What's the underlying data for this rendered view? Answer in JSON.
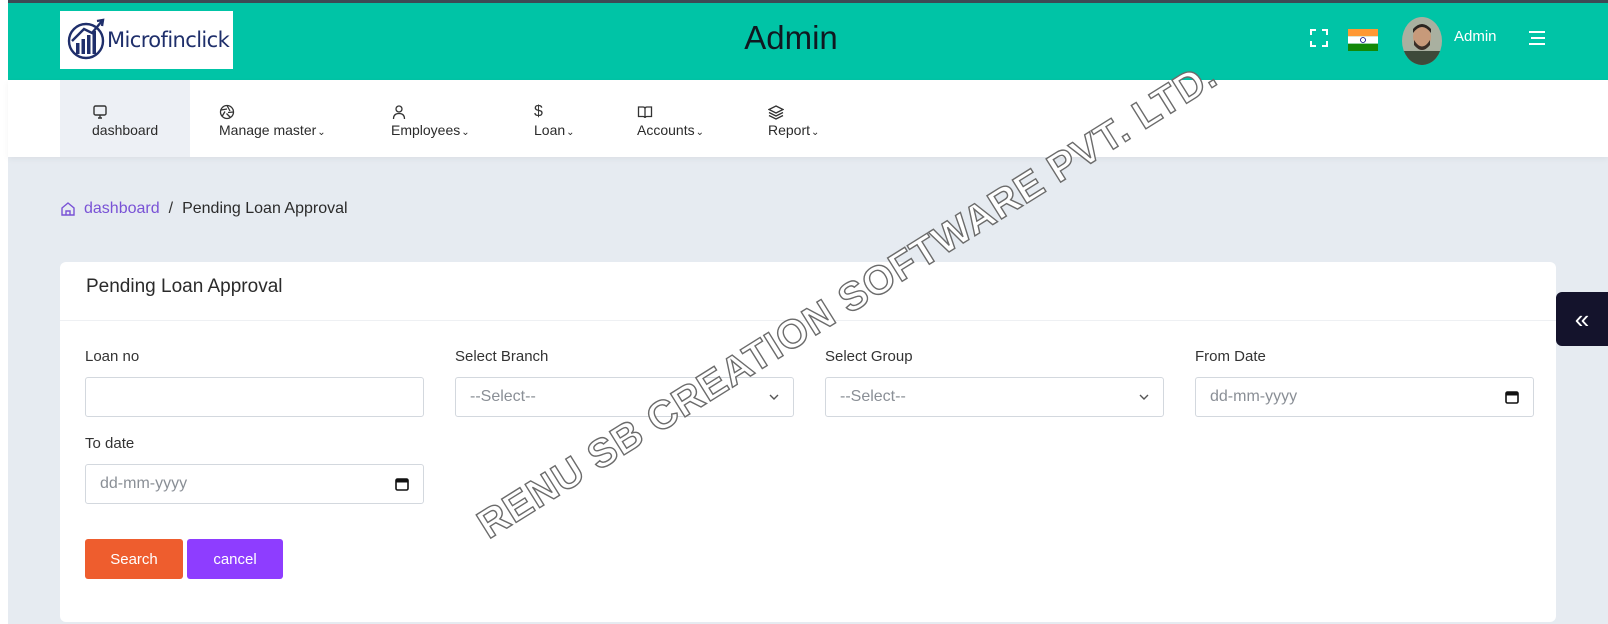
{
  "brand": {
    "logo_text": "Microfinclick"
  },
  "header": {
    "title": "Admin",
    "user_name": "Admin"
  },
  "nav": {
    "items": [
      {
        "label": "dashboard",
        "icon": "monitor-icon",
        "caret": ""
      },
      {
        "label": "Manage master",
        "icon": "aperture-icon",
        "caret": "⌄"
      },
      {
        "label": "Employees",
        "icon": "user-icon",
        "caret": "⌄"
      },
      {
        "label": "Loan",
        "icon": "dollar-icon",
        "caret": "⌄"
      },
      {
        "label": "Accounts",
        "icon": "book-icon",
        "caret": "⌄"
      },
      {
        "label": "Report",
        "icon": "layers-icon",
        "caret": "⌄"
      }
    ]
  },
  "breadcrumb": {
    "home": "dashboard",
    "separator": "/",
    "current": "Pending Loan Approval"
  },
  "form": {
    "title": "Pending Loan Approval",
    "loan_no": {
      "label": "Loan no",
      "value": ""
    },
    "branch": {
      "label": "Select Branch",
      "selected": "--Select--"
    },
    "group": {
      "label": "Select Group",
      "selected": "--Select--"
    },
    "from_date": {
      "label": "From Date",
      "placeholder": "dd-mm-yyyy"
    },
    "to_date": {
      "label": "To date",
      "placeholder": "dd-mm-yyyy"
    },
    "search_label": "Search",
    "cancel_label": "cancel"
  },
  "side_toggle": {
    "glyph": "«"
  },
  "watermark": "RENU SB CREATION SOFTWARE PVT. LTD.",
  "colors": {
    "header_bg": "#00c4a6",
    "page_bg": "#e6ebf1",
    "accent_purple": "#7952d6",
    "search_button": "#ee5d2e",
    "cancel_button": "#8e3dff",
    "side_toggle": "#14132c"
  }
}
